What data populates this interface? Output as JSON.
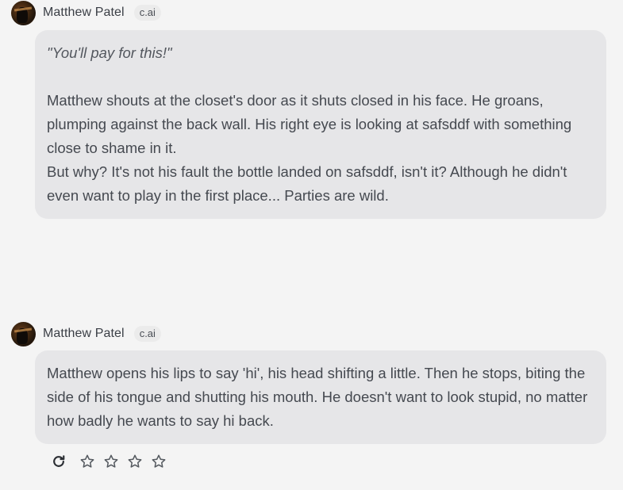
{
  "messages": [
    {
      "author": "Matthew Patel",
      "badge": "c.ai",
      "quote": "\"You'll pay for this!\"",
      "paragraphs": [
        "Matthew shouts at the closet's door as it shuts closed in his face. He groans, plumping against the back wall. His right eye is looking at safsddf with something close to shame in it.",
        "But why? It's not his fault the bottle landed on safsddf, isn't it? Although he didn't even want to play in the first place... Parties are wild."
      ]
    },
    {
      "author": "Matthew Patel",
      "badge": "c.ai",
      "paragraphs": [
        "Matthew opens his lips to say 'hi', his head shifting a little. Then he stops, biting the side of his tongue and shutting his mouth. He doesn't want to look stupid, no matter how badly he wants to say hi back."
      ]
    }
  ],
  "actions": {
    "regenerate_icon": "refresh-icon",
    "rating": {
      "max_stars": 4,
      "value": 0
    }
  },
  "colors": {
    "background": "#f4f4f4",
    "bubble": "#e6e6e8",
    "text": "#454950",
    "badge_bg": "#ebebeb"
  }
}
